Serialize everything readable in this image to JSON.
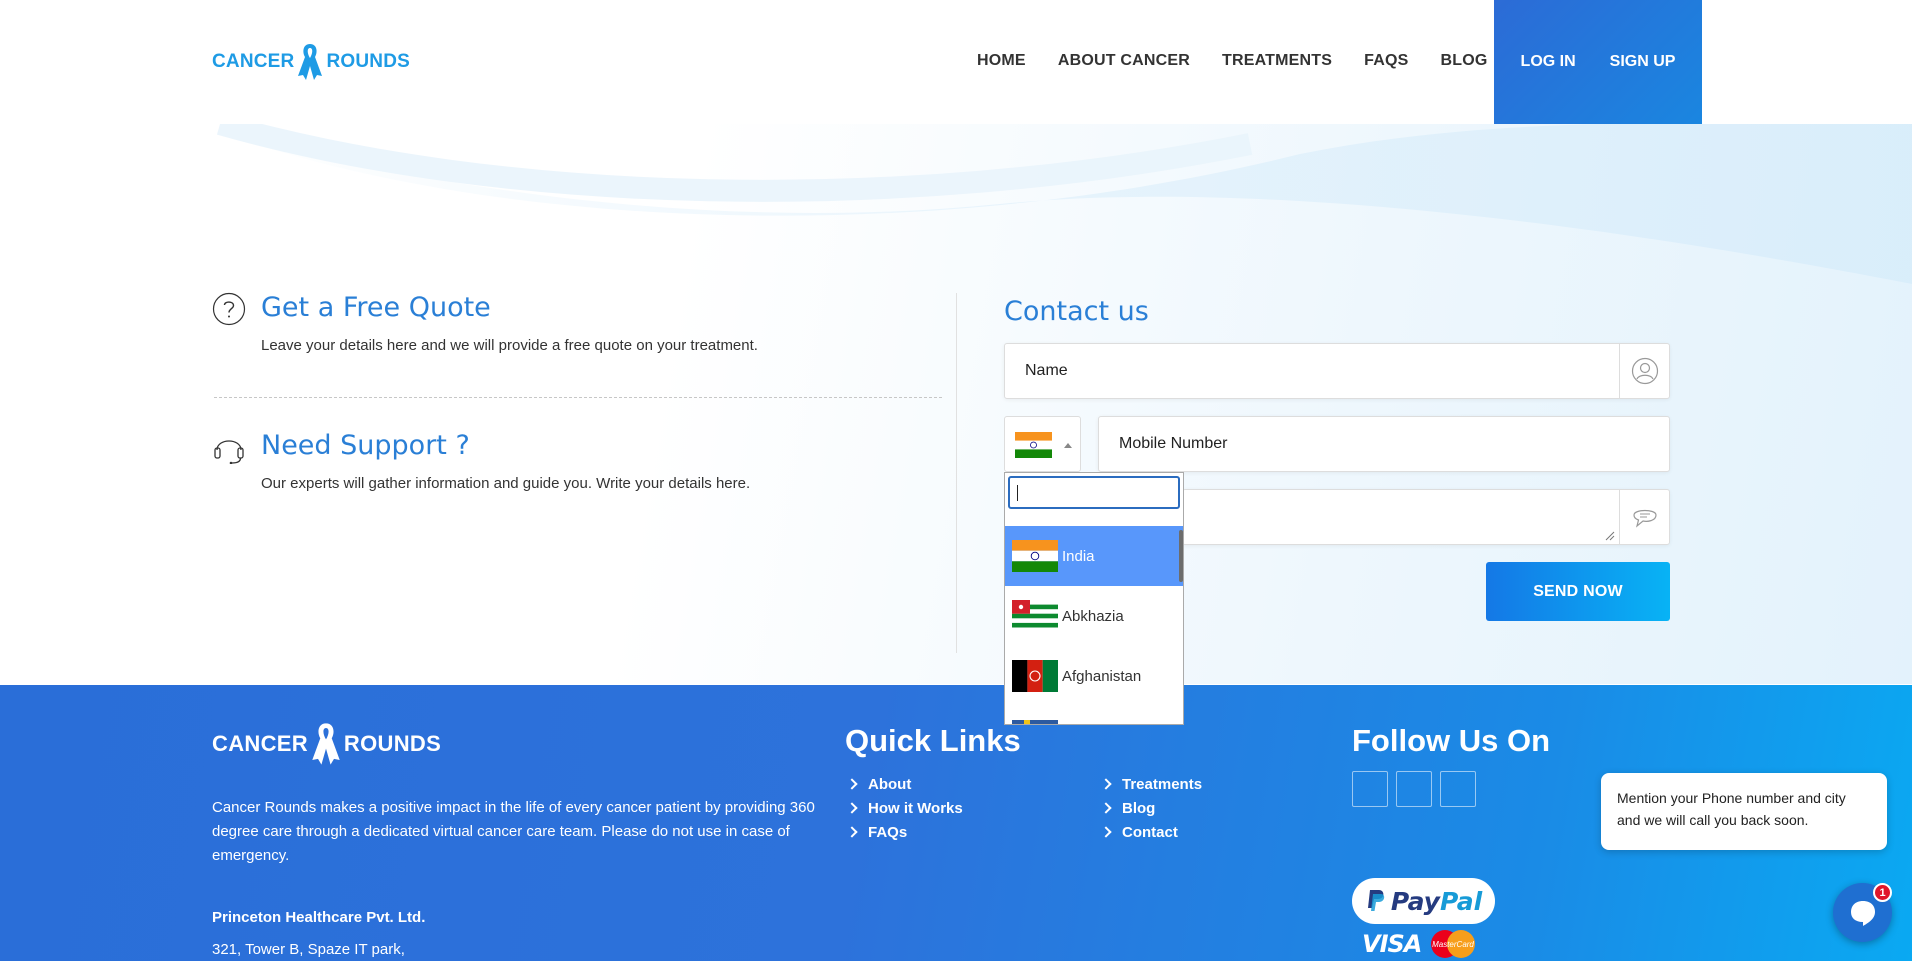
{
  "brand": {
    "name_left": "CANCER",
    "name_right": "ROUNDS",
    "color": "#1e9be5"
  },
  "nav": {
    "items": [
      "HOME",
      "ABOUT CANCER",
      "TREATMENTS",
      "FAQS",
      "BLOG"
    ],
    "login": "LOG IN",
    "signup": "SIGN UP"
  },
  "quote": {
    "icon": "question-circle-icon",
    "title": "Get a Free Quote",
    "desc": "Leave your details here and we will provide a free quote on your treatment."
  },
  "support": {
    "icon": "headset-icon",
    "title": "Need Support ?",
    "desc": "Our experts will gather information and guide you. Write your details here."
  },
  "contact": {
    "title": "Contact us",
    "name_placeholder": "Name",
    "name_icon": "user-icon",
    "country_selected": "India",
    "mobile_placeholder": "Mobile Number",
    "message_icon": "chat-bubble-icon",
    "send_label": "SEND NOW"
  },
  "country_dropdown": {
    "search_value": "",
    "options": [
      {
        "name": "India",
        "flag": "flag-india-icon",
        "selected": true
      },
      {
        "name": "Abkhazia",
        "flag": "flag-abkhazia-icon",
        "selected": false
      },
      {
        "name": "Afghanistan",
        "flag": "flag-afghanistan-icon",
        "selected": false
      }
    ]
  },
  "footer": {
    "about": "Cancer Rounds makes a positive impact in the life of every cancer patient by providing 360 degree care through a dedicated virtual cancer care team. Please do not use in case of emergency.",
    "company": "Princeton Healthcare Pvt. Ltd.",
    "address": "321, Tower B, Spaze IT park,",
    "quick_links_title": "Quick Links",
    "quick_links_col1": [
      "About",
      "How it Works",
      "FAQs"
    ],
    "quick_links_col2": [
      "Treatments",
      "Blog",
      "Contact"
    ],
    "follow_title": "Follow Us On",
    "payment": {
      "paypal_a": "Pay",
      "paypal_b": "Pal",
      "visa": "VISA",
      "mastercard": "MasterCard"
    }
  },
  "chat": {
    "message": "Mention your Phone number and city and we will call you back soon.",
    "badge_count": "1",
    "icon": "chat-icon"
  }
}
